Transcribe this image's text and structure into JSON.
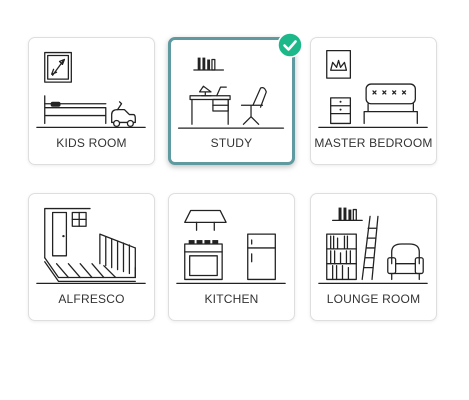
{
  "rooms": [
    {
      "id": "kids-room",
      "label": "KIDS ROOM",
      "selected": false,
      "icon": "kids-room-icon"
    },
    {
      "id": "study",
      "label": "STUDY",
      "selected": true,
      "icon": "study-icon"
    },
    {
      "id": "master-bedroom",
      "label": "MASTER BEDROOM",
      "selected": false,
      "icon": "bedroom-icon"
    },
    {
      "id": "alfresco",
      "label": "ALFRESCO",
      "selected": false,
      "icon": "alfresco-icon"
    },
    {
      "id": "kitchen",
      "label": "KITCHEN",
      "selected": false,
      "icon": "kitchen-icon"
    },
    {
      "id": "lounge-room",
      "label": "LOUNGE ROOM",
      "selected": false,
      "icon": "lounge-room-icon"
    }
  ],
  "colors": {
    "selected_border": "#5f9aa1",
    "check_badge": "#1db88a",
    "card_border": "#dedede",
    "label_text": "#333333"
  }
}
